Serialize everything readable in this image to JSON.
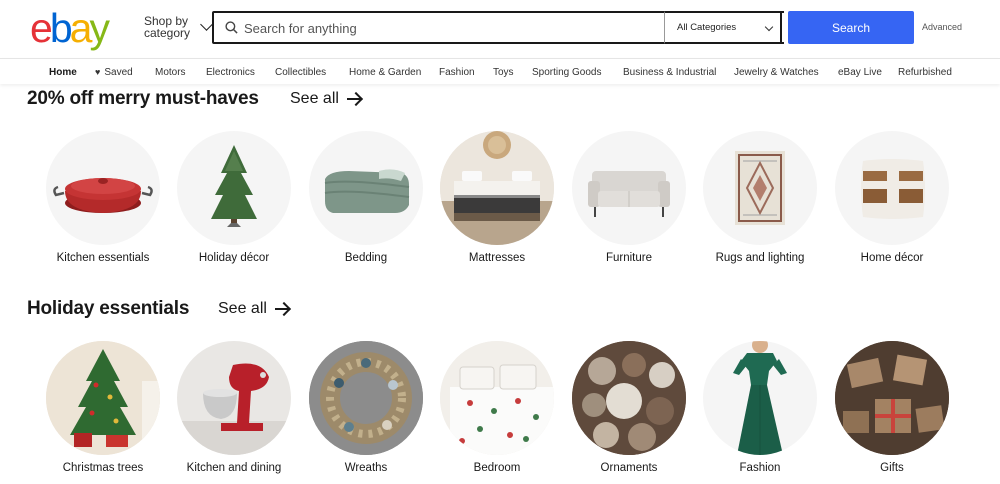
{
  "header": {
    "logo_letters": [
      "e",
      "b",
      "a",
      "y"
    ],
    "logo_colors": [
      "#e53238",
      "#0064d2",
      "#f5af02",
      "#86b817"
    ],
    "shop_by_label": "Shop by category",
    "search_placeholder": "Search for anything",
    "category_value": "All Categories",
    "search_button": "Search",
    "advanced_link": "Advanced",
    "accent_color": "#3665f3"
  },
  "nav": {
    "items": [
      "Home",
      "Saved",
      "Motors",
      "Electronics",
      "Collectibles",
      "Home & Garden",
      "Fashion",
      "Toys",
      "Sporting Goods",
      "Business & Industrial",
      "Jewelry & Watches",
      "eBay Live",
      "Refurbished"
    ]
  },
  "section1": {
    "title": "20% off merry must-haves",
    "see_all": "See all",
    "tiles": [
      {
        "label": "Kitchen essentials",
        "icon": "dutch-oven-image"
      },
      {
        "label": "Holiday décor",
        "icon": "christmas-tree-image"
      },
      {
        "label": "Bedding",
        "icon": "folded-blanket-image"
      },
      {
        "label": "Mattresses",
        "icon": "mattress-image"
      },
      {
        "label": "Furniture",
        "icon": "sofa-image"
      },
      {
        "label": "Rugs and lighting",
        "icon": "rug-image"
      },
      {
        "label": "Home décor",
        "icon": "pillow-image"
      }
    ]
  },
  "section2": {
    "title": "Holiday essentials",
    "see_all": "See all",
    "tiles": [
      {
        "label": "Christmas trees",
        "icon": "decorated-tree-image"
      },
      {
        "label": "Kitchen and dining",
        "icon": "stand-mixer-image"
      },
      {
        "label": "Wreaths",
        "icon": "wreath-image"
      },
      {
        "label": "Bedroom",
        "icon": "holiday-bedding-image"
      },
      {
        "label": "Ornaments",
        "icon": "ornaments-image"
      },
      {
        "label": "Fashion",
        "icon": "green-dress-image"
      },
      {
        "label": "Gifts",
        "icon": "wrapped-gifts-image"
      }
    ]
  }
}
